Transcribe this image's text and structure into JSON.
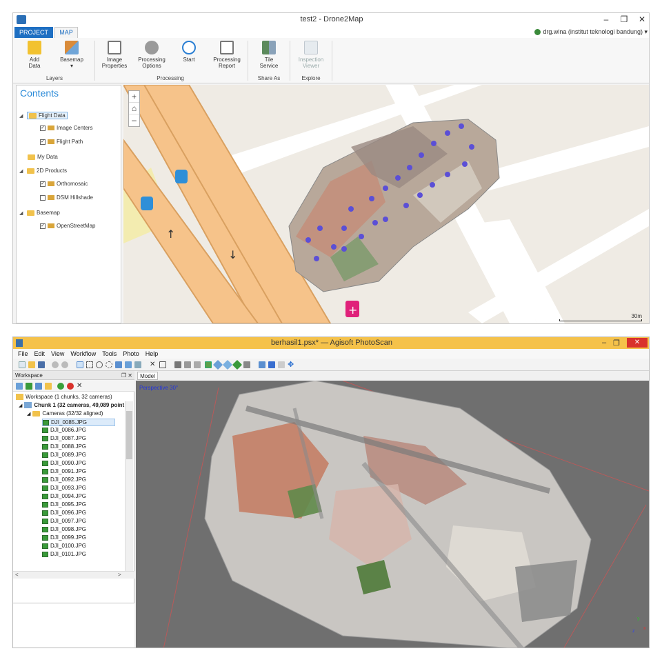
{
  "drone2map": {
    "title": "test2 - Drone2Map",
    "window_buttons": [
      "–",
      "❐",
      "✕"
    ],
    "tabs": {
      "project": "PROJECT",
      "map": "MAP"
    },
    "user": "drg.wina (institut teknologi bandung) ▾",
    "ribbon": {
      "add_data": "Add\nData",
      "basemap": "Basemap",
      "basemap_arrow": "▾",
      "image_properties": "Image\nProperties",
      "processing_options": "Processing\nOptions",
      "start": "Start",
      "processing_report": "Processing\nReport",
      "tile_service": "Tile\nService",
      "inspection_viewer": "Inspection\nViewer",
      "groups": {
        "layers": "Layers",
        "processing": "Processing",
        "share_as": "Share As",
        "explore": "Explore"
      }
    },
    "contents": {
      "title": "Contents",
      "flight_data": "Flight Data",
      "image_centers": "Image Centers",
      "flight_path": "Flight Path",
      "my_data": "My Data",
      "products_2d": "2D Products",
      "orthomosaic": "Orthomosaic",
      "dsm_hillshade": "DSM Hillshade",
      "basemap": "Basemap",
      "openstreetmap": "OpenStreetMap"
    },
    "map": {
      "zoom_in": "+",
      "home": "⌂",
      "zoom_out": "–",
      "scale": "30m"
    }
  },
  "photoscan": {
    "title": "berhasil1.psx* — Agisoft PhotoScan",
    "window_buttons": {
      "minimize": "–",
      "restore": "❐",
      "close": "✕"
    },
    "menu": [
      "File",
      "Edit",
      "View",
      "Workflow",
      "Tools",
      "Photo",
      "Help"
    ],
    "workspace": {
      "header": "Workspace",
      "header_buttons": "❐ ✕",
      "root": "Workspace (1 chunks, 32 cameras)",
      "chunk": "Chunk 1 (32 cameras, 49,089 point",
      "cameras_folder": "Cameras (32/32 aligned)",
      "cameras": [
        "DJI_0085.JPG",
        "DJI_0086.JPG",
        "DJI_0087.JPG",
        "DJI_0088.JPG",
        "DJI_0089.JPG",
        "DJI_0090.JPG",
        "DJI_0091.JPG",
        "DJI_0092.JPG",
        "DJI_0093.JPG",
        "DJI_0094.JPG",
        "DJI_0095.JPG",
        "DJI_0096.JPG",
        "DJI_0097.JPG",
        "DJI_0098.JPG",
        "DJI_0099.JPG",
        "DJI_0100.JPG",
        "DJI_0101.JPG"
      ],
      "hscroll_left": "<",
      "hscroll_right": ">"
    },
    "model_tab": "Model",
    "perspective": "Perspective 30°",
    "axes": {
      "x": "x",
      "y": "y",
      "z": "z"
    }
  },
  "colors": {
    "project_tab": "#1e6fc2",
    "photoscan_titlebar": "#f5c24a",
    "flight_point": "#5b4fd6",
    "road": "#f6c38a",
    "close_button": "#d9322c"
  }
}
